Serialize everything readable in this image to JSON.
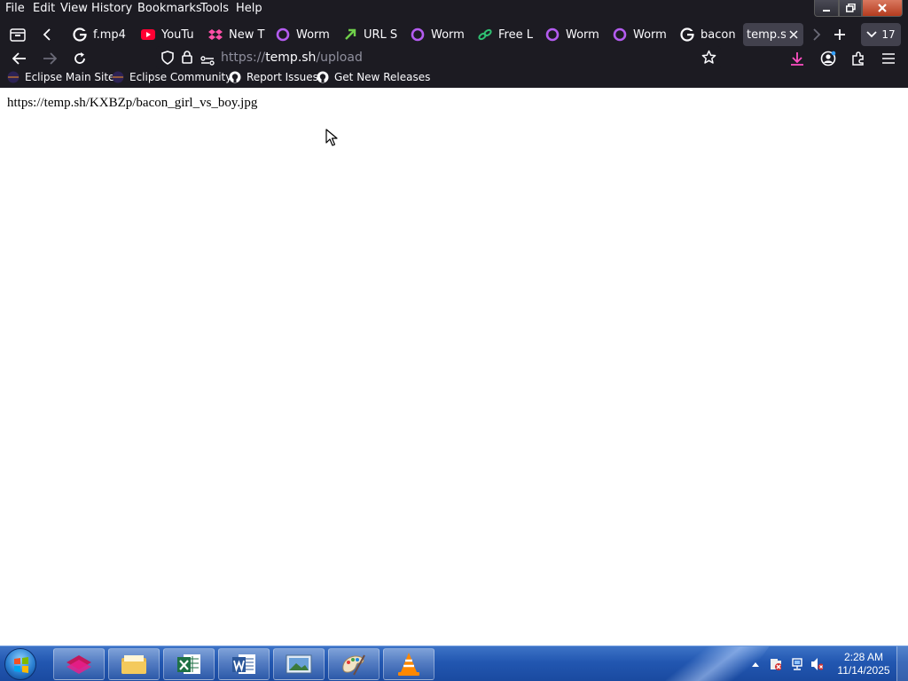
{
  "menubar": {
    "items": [
      {
        "label": "File"
      },
      {
        "label": "Edit"
      },
      {
        "label": "View"
      },
      {
        "label": "History"
      },
      {
        "label": "Bookmarks"
      },
      {
        "label": "Tools"
      },
      {
        "label": "Help"
      }
    ]
  },
  "tabs": [
    {
      "title": "f.mp4",
      "icon": "google-icon"
    },
    {
      "title": "YouTu",
      "icon": "youtube-icon"
    },
    {
      "title": "New T",
      "icon": "dropbox-icon"
    },
    {
      "title": "Worm",
      "icon": "worm-icon"
    },
    {
      "title": "URL Sh",
      "icon": "url-shortener-icon"
    },
    {
      "title": "Worm",
      "icon": "worm-icon"
    },
    {
      "title": "Free Li",
      "icon": "link-icon"
    },
    {
      "title": "Worm",
      "icon": "worm-icon"
    },
    {
      "title": "Worm",
      "icon": "worm-icon"
    },
    {
      "title": "bacon",
      "icon": "google-icon"
    },
    {
      "title": "temp.sh",
      "icon": "none",
      "active": true
    }
  ],
  "tab_count": "17",
  "urlbar": {
    "scheme": "https://",
    "host": "temp.sh",
    "path": "/upload"
  },
  "bookmarks": [
    {
      "label": "Eclipse Main Site",
      "icon": "eclipse-icon"
    },
    {
      "label": "Eclipse Community",
      "icon": "eclipse-icon"
    },
    {
      "label": "Report Issues",
      "icon": "github-icon"
    },
    {
      "label": "Get New Releases",
      "icon": "github-icon"
    }
  ],
  "page": {
    "result_url": "https://temp.sh/KXBZp/bacon_girl_vs_boy.jpg"
  },
  "taskbar": {
    "apps": [
      "media-app-icon",
      "file-explorer-icon",
      "excel-icon",
      "word-icon",
      "picture-viewer-icon",
      "paint-icon",
      "vlc-icon"
    ],
    "clock": {
      "time": "2:28 AM",
      "date": "11/14/2025"
    }
  },
  "colors": {
    "chrome_bg": "#1c1b22",
    "active_tab_accent": "#ff4fc4",
    "download_icon": "#ff4fc4",
    "taskbar": "#2257b1"
  }
}
